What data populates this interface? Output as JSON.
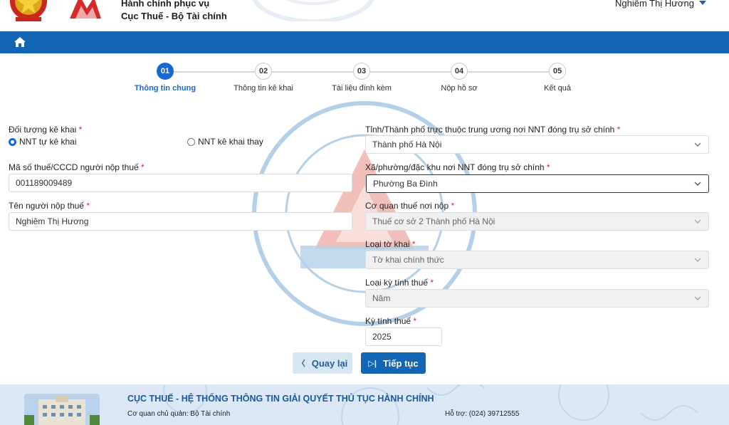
{
  "header": {
    "org_line1": "Hành chính phục vụ",
    "org_line2": "Cục Thuế - Bộ Tài chính",
    "user_name": "Nghiêm Thị Hương"
  },
  "stepper": {
    "steps": [
      {
        "number": "01",
        "label": "Thông tin chung",
        "active": true
      },
      {
        "number": "02",
        "label": "Thông tin kê khai",
        "active": false
      },
      {
        "number": "03",
        "label": "Tài liệu đính kèm",
        "active": false
      },
      {
        "number": "04",
        "label": "Nộp hồ sơ",
        "active": false
      },
      {
        "number": "05",
        "label": "Kết quả",
        "active": false
      }
    ]
  },
  "form": {
    "declarant_type": {
      "label": "Đối tượng kê khai",
      "options": [
        "NNT tự kê khai",
        "NNT kê khai thay"
      ],
      "selected": "NNT tự kê khai"
    },
    "tax_id": {
      "label": "Mã số thuế/CCCD người nộp thuế",
      "value": "001189009489"
    },
    "taxpayer_name": {
      "label": "Tên người nộp thuế",
      "value": "Nghiêm Thị Hương"
    },
    "province": {
      "label": "Tỉnh/Thành phố trực thuộc trung ương nơi NNT đóng trụ sở chính",
      "value": "Thành phố Hà Nội"
    },
    "ward": {
      "label": "Xã/phường/đặc khu nơi NNT đóng trụ sở chính",
      "value": "Phường Ba Đình"
    },
    "tax_office": {
      "label": "Cơ quan thuế nơi nộp",
      "value": "Thuế cơ sở 2 Thành phố Hà Nội"
    },
    "declaration_type": {
      "label": "Loại tờ khai",
      "value": "Tờ khai chính thức"
    },
    "period_type": {
      "label": "Loại kỳ tính thuế",
      "value": "Năm"
    },
    "period": {
      "label": "Kỳ tính thuế",
      "value": "2025"
    },
    "required_mark": "*"
  },
  "actions": {
    "back_label": "Quay lại",
    "next_label": "Tiếp tục"
  },
  "footer": {
    "title": "CỤC THUẾ - HỆ THỐNG THÔNG TIN GIẢI QUYẾT THỦ TỤC HÀNH CHÍNH",
    "agency_label": "Cơ quan chủ quản:",
    "agency_value": "Bộ Tài chính",
    "support_label": "Hỗ trợ:",
    "support_value": "(024) 39712555"
  },
  "colors": {
    "primary": "#1366b3",
    "active_step": "#1a66d2",
    "required": "#e02424"
  }
}
